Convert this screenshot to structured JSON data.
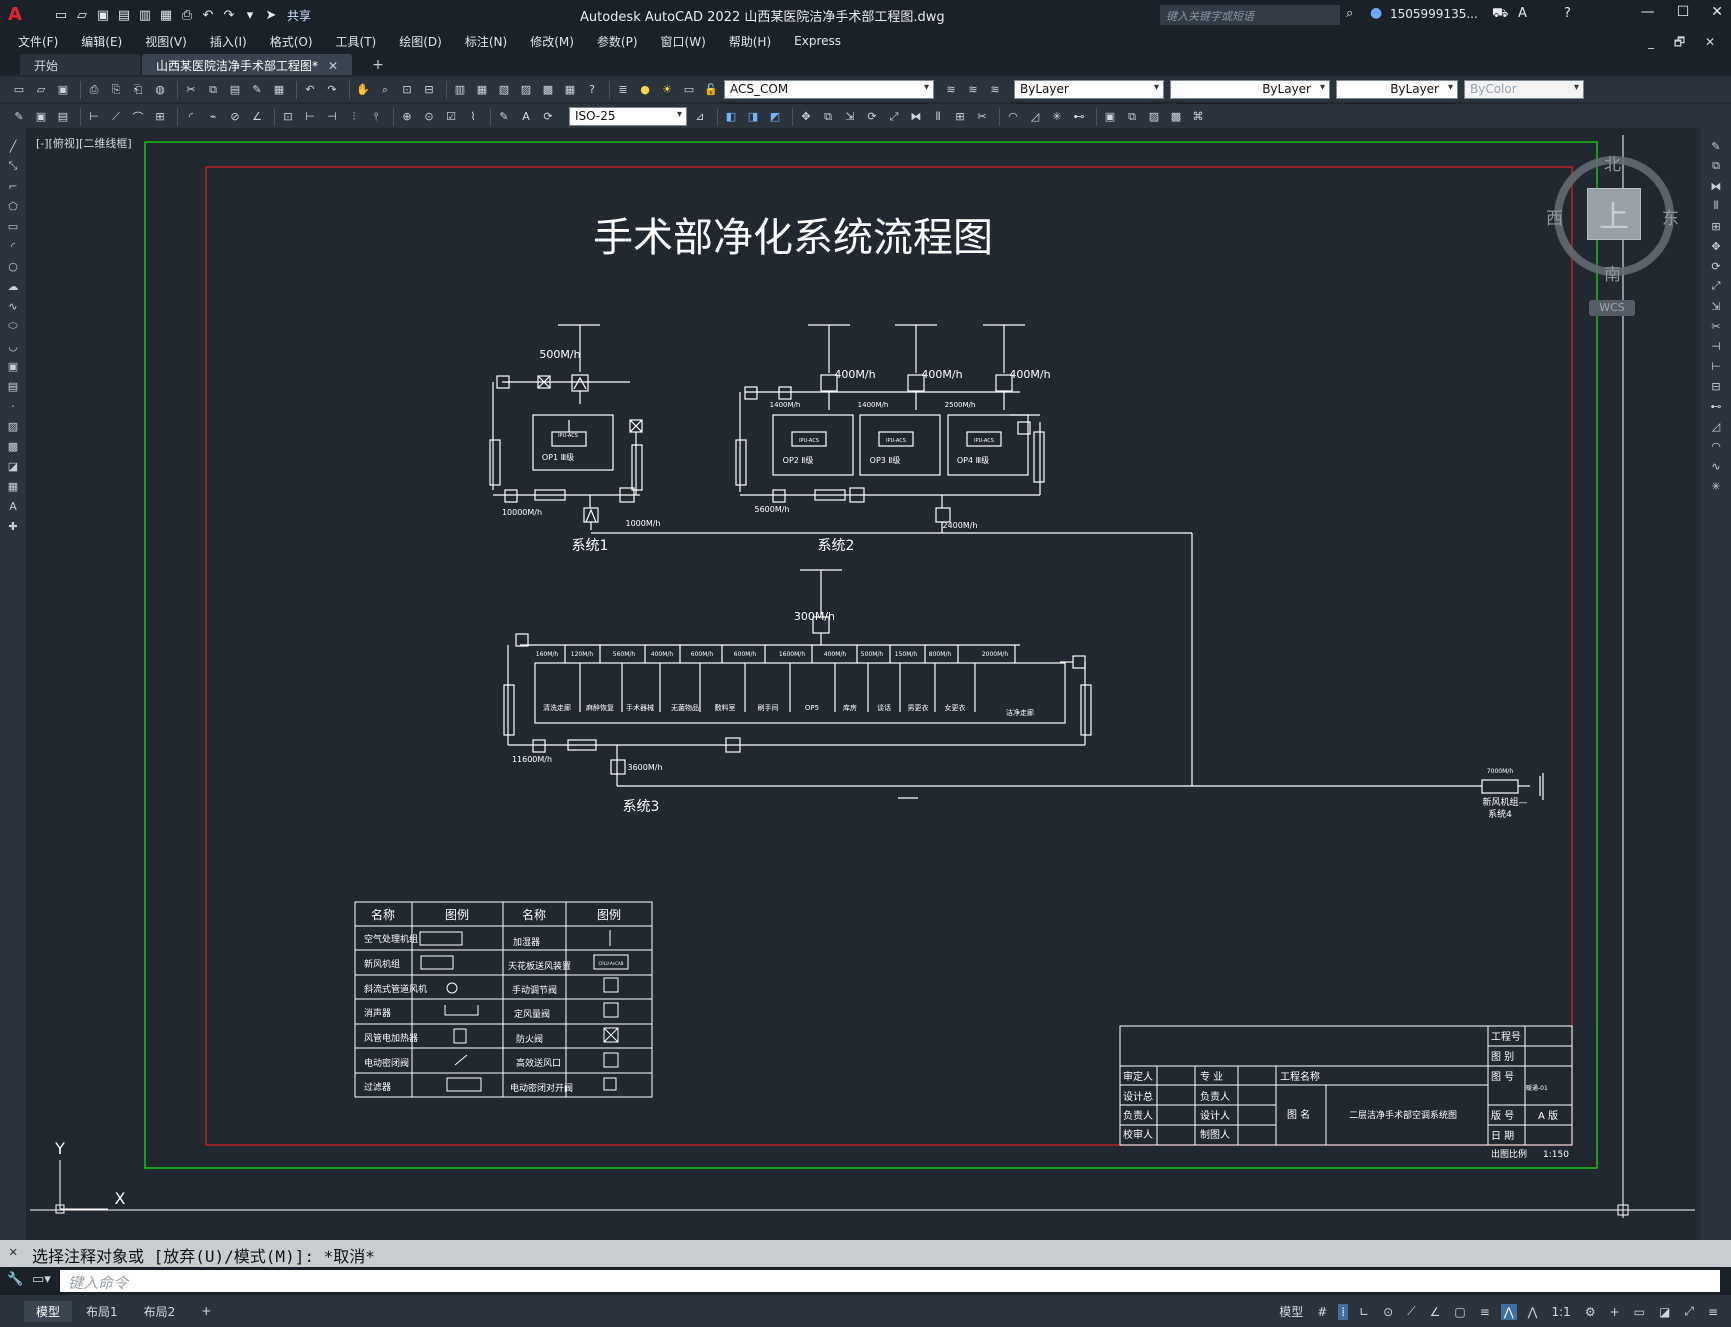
{
  "app": {
    "logo": "A",
    "title": "Autodesk AutoCAD 2022    山西某医院洁净手术部工程图.dwg",
    "share_label": "共享",
    "search_placeholder": "键入关键字或短语",
    "user": "1505999135...",
    "window_buttons": [
      "—",
      "☐",
      "✕"
    ]
  },
  "menu": {
    "items": [
      "文件(F)",
      "编辑(E)",
      "视图(V)",
      "插入(I)",
      "格式(O)",
      "工具(T)",
      "绘图(D)",
      "标注(N)",
      "修改(M)",
      "参数(P)",
      "窗口(W)",
      "帮助(H)",
      "Express"
    ],
    "right": "_ 🗗 ✕"
  },
  "tabs": {
    "items": [
      {
        "label": "开始"
      },
      {
        "label": "山西某医院洁净手术部工程图*"
      }
    ],
    "close": "✕",
    "add": "+"
  },
  "toolbar1": {
    "layer": "ACS_COM",
    "color": "ByLayer",
    "linetype": "ByLayer",
    "lineweight": "ByLayer",
    "plotstyle": "ByColor"
  },
  "toolbar2": {
    "dimstyle": "ISO-25"
  },
  "viewport": {
    "label": "[-][俯视][二维线框]"
  },
  "viewcube": {
    "north": "北",
    "south": "南",
    "east": "东",
    "west": "西",
    "face": "上",
    "wcs": "WCS"
  },
  "ucs": {
    "x": "X",
    "y": "Y"
  },
  "drawing": {
    "title": "手术部净化系统流程图",
    "system1": {
      "label": "系统1",
      "airflow_top": "500M/h",
      "unit": "OP1 Ⅲ级",
      "unit_tag": "IPU-ACS",
      "left_flow": "10000M/h",
      "right_flow": "1000M/h"
    },
    "system2": {
      "label": "系统2",
      "flows_top": [
        "400M/h",
        "400M/h",
        "400M/h"
      ],
      "flows_branch": [
        "1400M/h",
        "1400M/h",
        "2500M/h"
      ],
      "units": [
        "OP2 Ⅱ级",
        "OP3 Ⅱ级",
        "OP4 Ⅲ级"
      ],
      "unit_tag": "IPU-ACS",
      "left_flow": "5600M/h",
      "right_flow": "2400M/h"
    },
    "system3": {
      "label": "系统3",
      "airflow_top": "300M/h",
      "branch_flows": [
        "160M/h",
        "120M/h",
        "560M/h",
        "400M/h",
        "600M/h",
        "600M/h",
        "1600M/h",
        "400M/h",
        "500M/h",
        "150M/h",
        "800M/h",
        "2000M/h"
      ],
      "rooms": [
        "清洗走廊",
        "麻醉恢复",
        "手术器械",
        "无菌物品",
        "敷料室",
        "刷手间",
        "OP5",
        "库房",
        "谈话",
        "男更衣",
        "女更衣",
        "洁净走廊"
      ],
      "left_flow": "11600M/h",
      "right_flow": "3600M/h"
    },
    "system4": {
      "flow": "7000M/h",
      "label1": "新风机组—",
      "label2": "系统4"
    },
    "legend": {
      "headers": [
        "名称",
        "图例",
        "名称",
        "图例"
      ],
      "rows": [
        [
          "空气处理机组",
          "加湿器"
        ],
        [
          "新风机组",
          "天花板送风装置"
        ],
        [
          "斜流式管道风机",
          "手动调节阀"
        ],
        [
          "消声器",
          "定风量阀"
        ],
        [
          "风管电加热器",
          "防火阀"
        ],
        [
          "电动密闭阀",
          "高效送风口"
        ],
        [
          "过滤器",
          "电动密闭对开阀"
        ]
      ],
      "symbol_tag": "CPLU-AnCAB"
    },
    "titleblock": {
      "labels_left": [
        "审定人",
        "设计总",
        "负责人",
        "校审人"
      ],
      "labels_mid": [
        "专  业",
        "负责人",
        "设计人",
        "制图人"
      ],
      "project_label": "工程名称",
      "drawing_name_label": "图  名",
      "drawing_name": "二层洁净手术部空调系统图",
      "right_labels": [
        "工程号",
        "图  别",
        "图  号",
        "版  号",
        "日  期"
      ],
      "drawing_no": "暖通-01",
      "version": "A 版",
      "scale_label": "出图比例",
      "scale": "1:150"
    }
  },
  "command": {
    "history": "选择注释对象或 [放弃(U)/模式(M)]: *取消*",
    "placeholder": "键入命令"
  },
  "status": {
    "layouts": [
      "模型",
      "布局1",
      "布局2"
    ],
    "add": "+",
    "model_label": "模型",
    "scale": "1:1"
  }
}
